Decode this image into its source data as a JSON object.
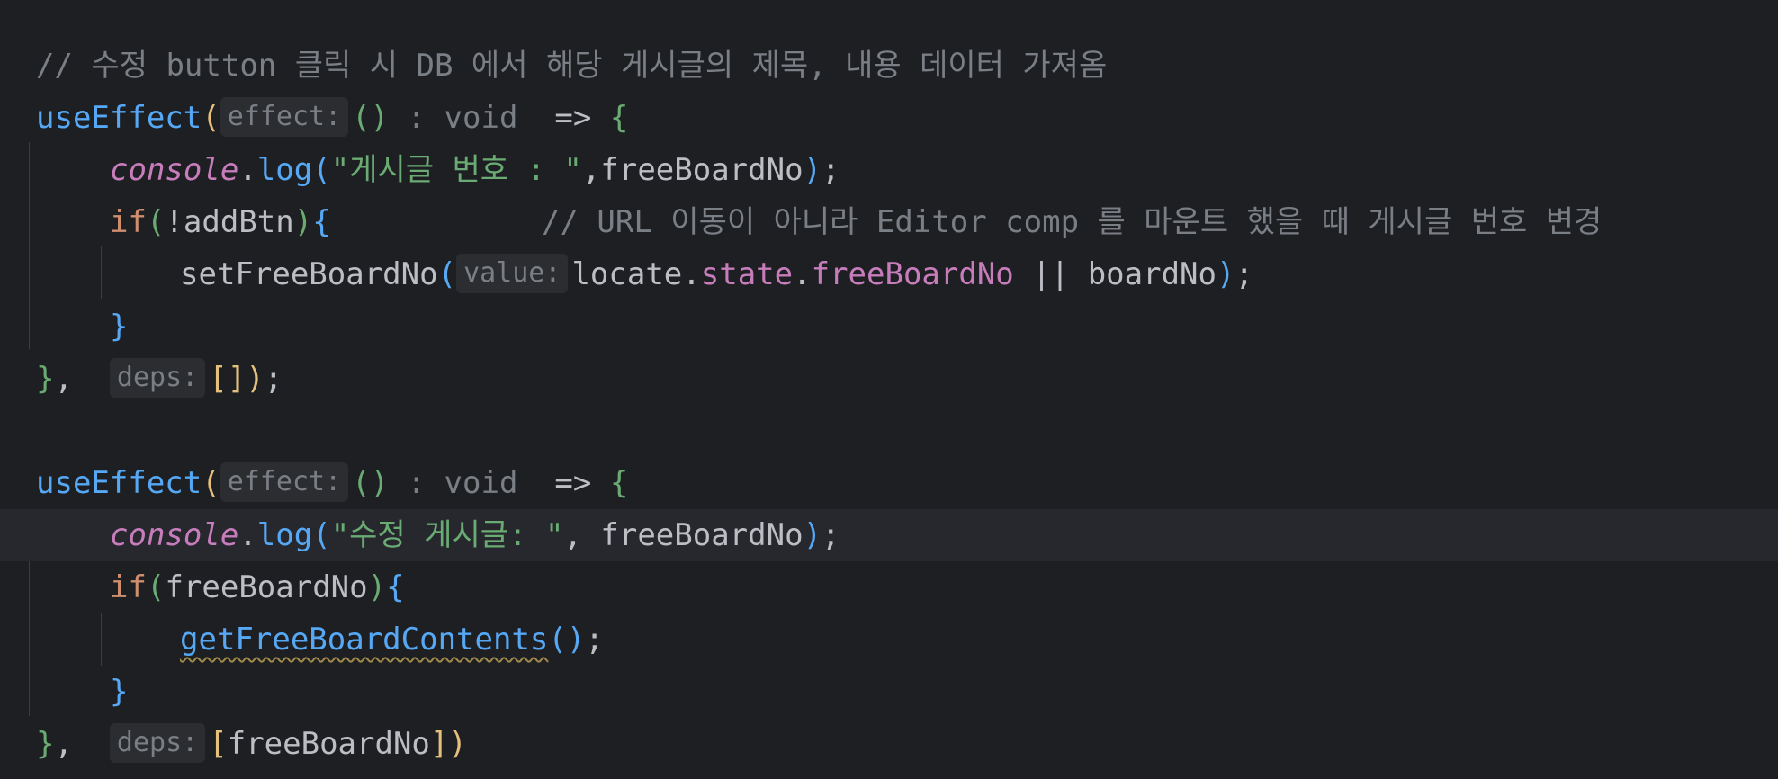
{
  "editor": {
    "comment_top": "// 수정 button 클릭 시 DB 에서 해당 게시글의 제목, 내용 데이터 가져옴",
    "use_effect": "useEffect",
    "hint_effect": "effect:",
    "hint_void": ": void",
    "arrow": "=>",
    "console": "console",
    "log": "log",
    "str1": "\"게시글 번호 : \"",
    "str2": "\"수정 게시글: \"",
    "freeBoardNo": "freeBoardNo",
    "if_kw": "if",
    "not_addBtn": "!addBtn",
    "comment_inline": "// URL 이동이 아니라 Editor comp 를 마운트 했을 때 게시글 번호 변경",
    "setFreeBoardNo": "setFreeBoardNo",
    "hint_value": "value:",
    "locate": "locate",
    "state": "state",
    "or_op": "||",
    "boardNo": "boardNo",
    "hint_deps": "deps:",
    "getFreeBoardContents": "getFreeBoardContents"
  },
  "colors": {
    "background": "#1e1f22",
    "function": "#56a8f5",
    "string": "#6aab73",
    "keyword": "#cf8e6d",
    "comment": "#7a7e85",
    "property": "#c77dbb"
  }
}
